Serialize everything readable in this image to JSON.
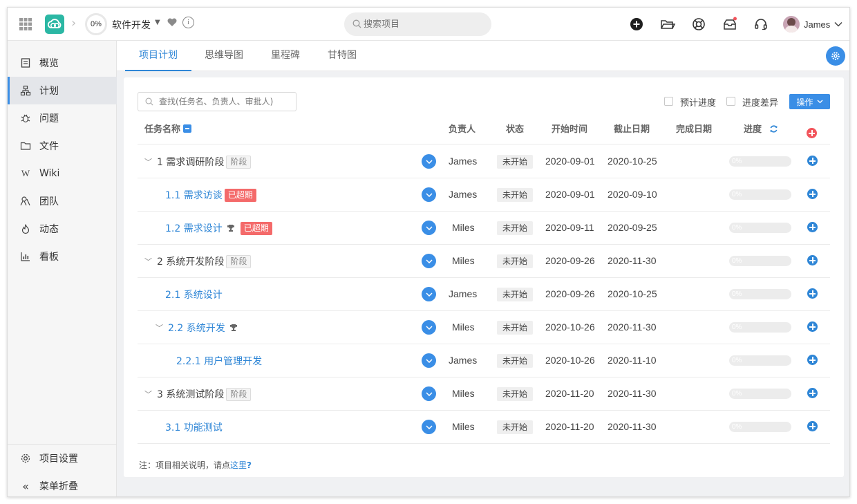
{
  "header": {
    "project_progress": "0%",
    "project_name": "软件开发",
    "search_placeholder": "搜索项目",
    "user_name": "James"
  },
  "sidebar": {
    "items": [
      {
        "label": "概览",
        "icon": "overview-icon"
      },
      {
        "label": "计划",
        "icon": "plan-icon",
        "active": true
      },
      {
        "label": "问题",
        "icon": "bug-icon"
      },
      {
        "label": "文件",
        "icon": "folder-icon"
      },
      {
        "label": "Wiki",
        "icon": "wiki-icon"
      },
      {
        "label": "团队",
        "icon": "team-icon"
      },
      {
        "label": "动态",
        "icon": "activity-icon"
      },
      {
        "label": "看板",
        "icon": "board-icon"
      }
    ],
    "settings_label": "项目设置",
    "collapse_label": "菜单折叠"
  },
  "tabs": [
    {
      "label": "项目计划",
      "active": true
    },
    {
      "label": "思维导图"
    },
    {
      "label": "里程碑"
    },
    {
      "label": "甘特图"
    }
  ],
  "toolbar": {
    "find_placeholder": "查找(任务名、负责人、审批人)",
    "expected_progress_label": "预计进度",
    "progress_diff_label": "进度差异",
    "action_label": "操作"
  },
  "table": {
    "columns": {
      "name": "任务名称",
      "owner": "负责人",
      "status": "状态",
      "start": "开始时间",
      "due": "截止日期",
      "done": "完成日期",
      "progress": "进度"
    },
    "rows": [
      {
        "name": "1 需求调研阶段",
        "type": "phase",
        "tag": "阶段",
        "owner": "James",
        "status": "未开始",
        "start": "2020-09-01",
        "due": "2020-10-25",
        "progress": "0%"
      },
      {
        "name": "1.1 需求访谈",
        "type": "task",
        "tag": "已超期",
        "owner": "James",
        "status": "未开始",
        "start": "2020-09-01",
        "due": "2020-09-10",
        "progress": "0%"
      },
      {
        "name": "1.2 需求设计",
        "type": "task",
        "trophy": true,
        "tag": "已超期",
        "owner": "Miles",
        "status": "未开始",
        "start": "2020-09-11",
        "due": "2020-09-25",
        "progress": "0%"
      },
      {
        "name": "2 系统开发阶段",
        "type": "phase",
        "tag": "阶段",
        "owner": "Miles",
        "status": "未开始",
        "start": "2020-09-26",
        "due": "2020-11-30",
        "progress": "0%"
      },
      {
        "name": "2.1 系统设计",
        "type": "task",
        "owner": "James",
        "status": "未开始",
        "start": "2020-09-26",
        "due": "2020-10-25",
        "progress": "0%"
      },
      {
        "name": "2.2 系统开发",
        "type": "subphase",
        "trophy": true,
        "owner": "Miles",
        "status": "未开始",
        "start": "2020-10-26",
        "due": "2020-11-30",
        "progress": "0%"
      },
      {
        "name": "2.2.1 用户管理开发",
        "type": "subtask",
        "owner": "James",
        "status": "未开始",
        "start": "2020-10-26",
        "due": "2020-11-10",
        "progress": "0%"
      },
      {
        "name": "3 系统测试阶段",
        "type": "phase",
        "tag": "阶段",
        "owner": "Miles",
        "status": "未开始",
        "start": "2020-11-20",
        "due": "2020-11-30",
        "progress": "0%"
      },
      {
        "name": "3.1 功能测试",
        "type": "task",
        "owner": "Miles",
        "status": "未开始",
        "start": "2020-11-20",
        "due": "2020-11-30",
        "progress": "0%"
      }
    ]
  },
  "footer_note": {
    "prefix": "注：项目相关说明，请点",
    "link": "这里",
    "suffix": "?"
  },
  "colors": {
    "accent": "#3a8ee6",
    "logo": "#2bb7a4",
    "overdue": "#f46a6a",
    "add_red": "#f2545b"
  }
}
